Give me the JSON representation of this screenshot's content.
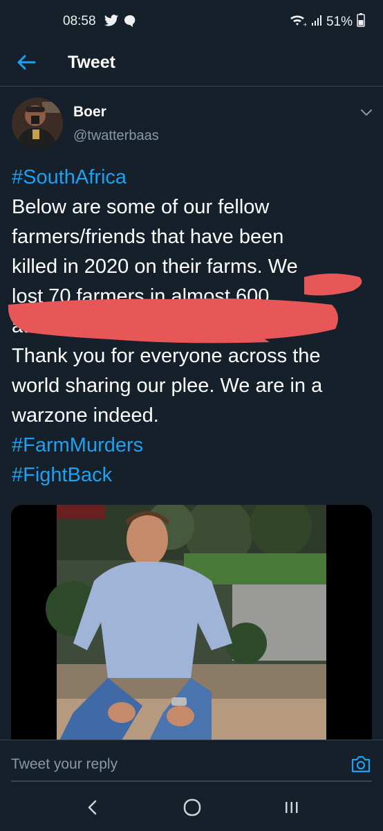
{
  "status_bar": {
    "time": "08:58",
    "battery": "51%",
    "icons": [
      "twitter-icon",
      "message-icon",
      "wifi-icon",
      "signal-icon",
      "battery-icon"
    ]
  },
  "header": {
    "title": "Tweet",
    "back_icon": "arrow-left-icon"
  },
  "tweet": {
    "author_name": "Boer",
    "author_handle": "@twatterbaas",
    "lines": [
      "#SouthAfrica",
      "Below are some of our fellow",
      "farmers/friends that have been",
      "killed in 2020 on their farms. We",
      "lost 70 farmers in almost 600",
      "attacks",
      "Thank you for everyone across the",
      "world sharing our plee. We are in a",
      "warzone indeed.",
      "#FarmMurders",
      "#FightBack"
    ]
  },
  "reply": {
    "placeholder": "Tweet your reply"
  },
  "colors": {
    "background": "#15202b",
    "accent": "#1da1f2",
    "muted": "#8899a6",
    "divider": "#38444d",
    "scribble": "#e85757"
  }
}
